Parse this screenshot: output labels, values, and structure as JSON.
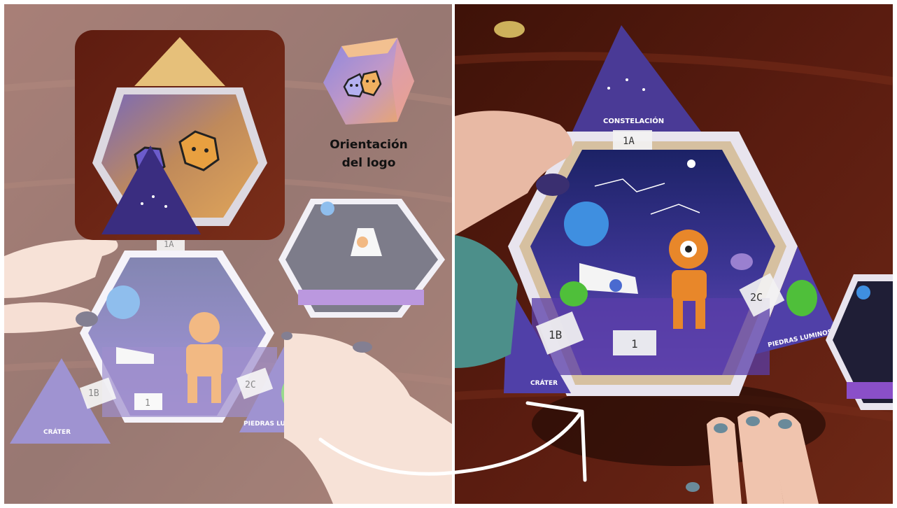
{
  "legend": {
    "line1": "Orientación",
    "line2": "del logo"
  },
  "card_labels": {
    "top": "CONSTELACIÓN",
    "left": "CRÁTER",
    "right": "PIEDRAS LUMINOSAS"
  },
  "sticky_tags": {
    "top": "1A",
    "left": "1B",
    "right": "2C",
    "center": "1"
  },
  "colors": {
    "table_wood": "#5a1c12",
    "card_purple": "#4b3a9a",
    "card_night": "#1c1f52",
    "robot_orange": "#e8872a",
    "planet_blue": "#3f8fe0",
    "gem_green": "#4fbf3a",
    "arrow": "#ffffff"
  }
}
